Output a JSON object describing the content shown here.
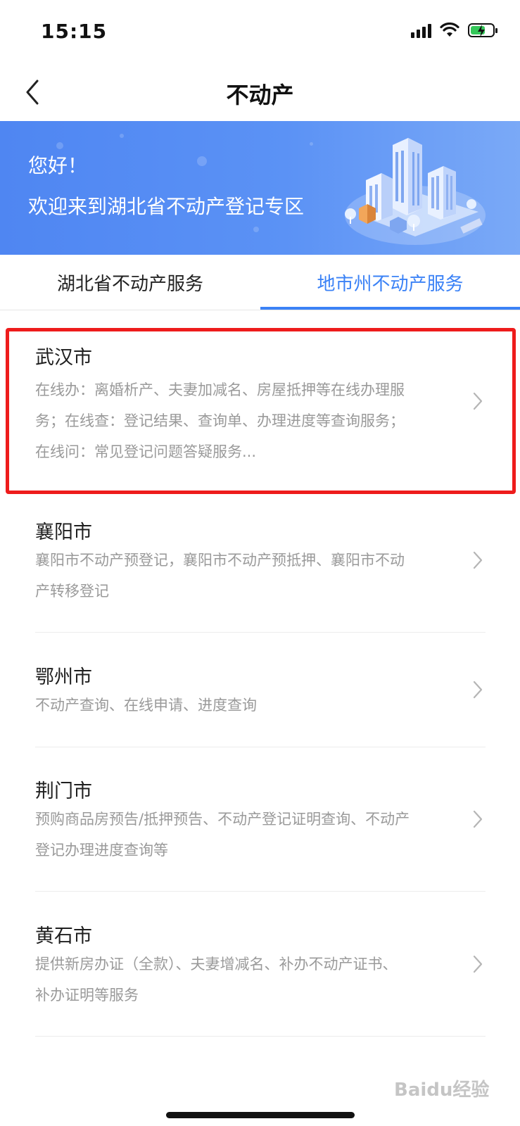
{
  "status_bar": {
    "time": "15:15",
    "icons": [
      "signal-icon",
      "wifi-icon",
      "battery-charging-icon"
    ]
  },
  "nav": {
    "title": "不动产",
    "back_icon": "chevron-left-icon"
  },
  "banner": {
    "greeting": "您好！",
    "welcome": "欢迎来到湖北省不动产登记专区",
    "background_color": "#5a8ff4"
  },
  "tabs": [
    {
      "label": "湖北省不动产服务",
      "active": false
    },
    {
      "label": "地市州不动产服务",
      "active": true
    }
  ],
  "accent_color": "#3b82f6",
  "list": [
    {
      "title": "武汉市",
      "desc_lines": [
        "在线办：离婚析产、夫妻加减名、房屋抵押等在线办理服",
        "务；在线查：登记结果、查询单、办理进度等查询服务；",
        "在线问：常见登记问题答疑服务..."
      ],
      "highlighted": true
    },
    {
      "title": "襄阳市",
      "desc_lines": [
        "襄阳市不动产预登记，襄阳市不动产预抵押、襄阳市不动",
        "产转移登记"
      ],
      "highlighted": false
    },
    {
      "title": "鄂州市",
      "desc_lines": [
        "不动产查询、在线申请、进度查询"
      ],
      "highlighted": false
    },
    {
      "title": "荆门市",
      "desc_lines": [
        "预购商品房预告/抵押预告、不动产登记证明查询、不动产",
        "登记办理进度查询等"
      ],
      "highlighted": false
    },
    {
      "title": "黄石市",
      "desc_lines": [
        "提供新房办证（全款）、夫妻增减名、补办不动产证书、",
        "补办证明等服务"
      ],
      "highlighted": false
    }
  ],
  "highlight_color": "#ee1c1c",
  "watermark": "Baidu经验"
}
